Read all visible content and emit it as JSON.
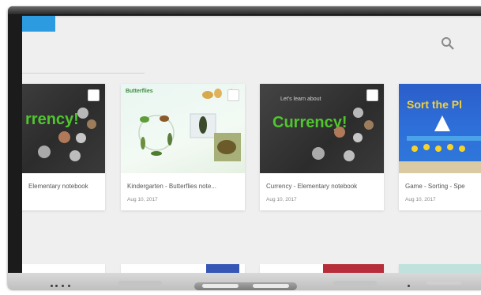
{
  "app": {
    "active_tab_label": "",
    "search_icon": "search-icon"
  },
  "cards": [
    {
      "title": "Elementary notebook",
      "date": "",
      "thumb_heading": "",
      "thumb_big_text": "rrency!",
      "style": "dark"
    },
    {
      "title": "Kindergarten - Butterflies note...",
      "date": "Aug 10, 2017",
      "thumb_heading": "Butterflies",
      "thumb_big_text": "",
      "style": "light"
    },
    {
      "title": "Currency - Elementary notebook",
      "date": "Aug 10, 2017",
      "thumb_heading": "Let's learn about",
      "thumb_big_text": "Currency!",
      "style": "dark"
    },
    {
      "title": "Game - Sorting - Spe",
      "date": "Aug 10, 2017",
      "thumb_heading": "Sort the Pl",
      "thumb_big_text": "",
      "style": "blue"
    }
  ],
  "colors": {
    "accent": "#2d9be0",
    "screen_bg": "#efefef",
    "currency_green": "#4fc62e"
  }
}
